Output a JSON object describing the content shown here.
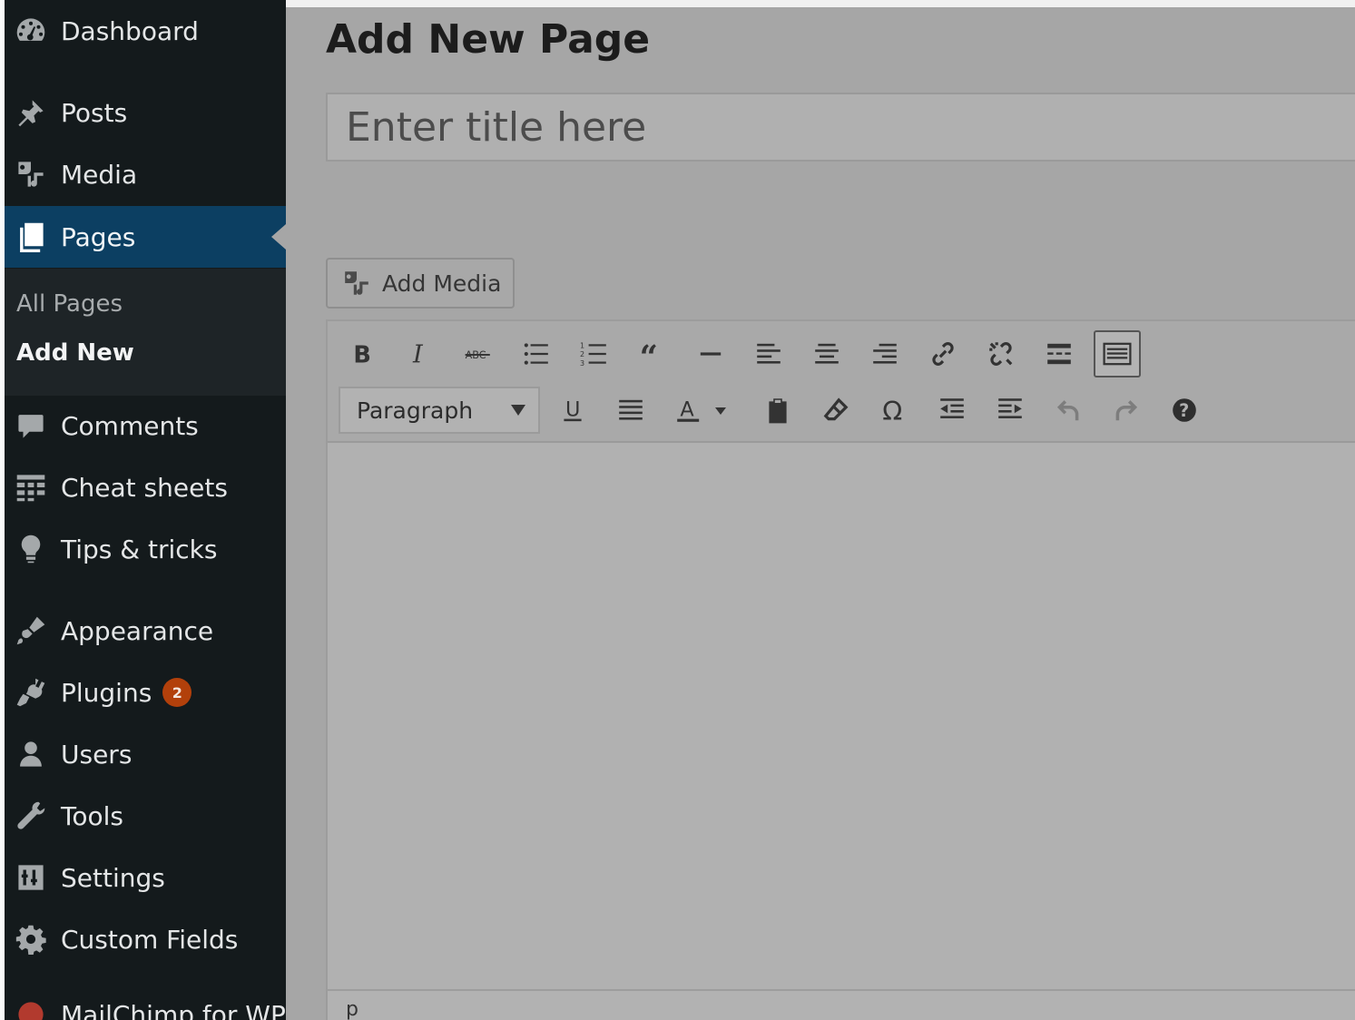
{
  "sidebar": {
    "items": [
      {
        "key": "dashboard",
        "label": "Dashboard",
        "icon": "dashboard-icon"
      },
      {
        "key": "posts",
        "label": "Posts",
        "icon": "pushpin-icon"
      },
      {
        "key": "media",
        "label": "Media",
        "icon": "media-icon"
      },
      {
        "key": "pages",
        "label": "Pages",
        "icon": "pages-icon",
        "active": true
      },
      {
        "key": "comments",
        "label": "Comments",
        "icon": "comment-icon"
      },
      {
        "key": "cheat-sheets",
        "label": "Cheat sheets",
        "icon": "grid-icon"
      },
      {
        "key": "tips",
        "label": "Tips & tricks",
        "icon": "lightbulb-icon"
      },
      {
        "key": "appearance",
        "label": "Appearance",
        "icon": "paintbrush-icon"
      },
      {
        "key": "plugins",
        "label": "Plugins",
        "icon": "plug-icon",
        "badge": "2"
      },
      {
        "key": "users",
        "label": "Users",
        "icon": "user-icon"
      },
      {
        "key": "tools",
        "label": "Tools",
        "icon": "wrench-icon"
      },
      {
        "key": "settings",
        "label": "Settings",
        "icon": "settings-icon"
      },
      {
        "key": "custom-fields",
        "label": "Custom Fields",
        "icon": "gear-icon"
      },
      {
        "key": "mailchimp",
        "label": "MailChimp for WP",
        "icon": "mailchimp-icon"
      }
    ],
    "submenu": {
      "all_pages": "All Pages",
      "add_new": "Add New"
    }
  },
  "main": {
    "page_title": "Add New Page",
    "title_placeholder": "Enter title here",
    "add_media_label": "Add Media",
    "format_select": "Paragraph",
    "status_path": "p"
  },
  "colors": {
    "sidebar_bg": "#141a1c",
    "active_bg": "#0c3f62",
    "badge_bg": "#b2400b",
    "content_bg": "#a6a6a6"
  }
}
